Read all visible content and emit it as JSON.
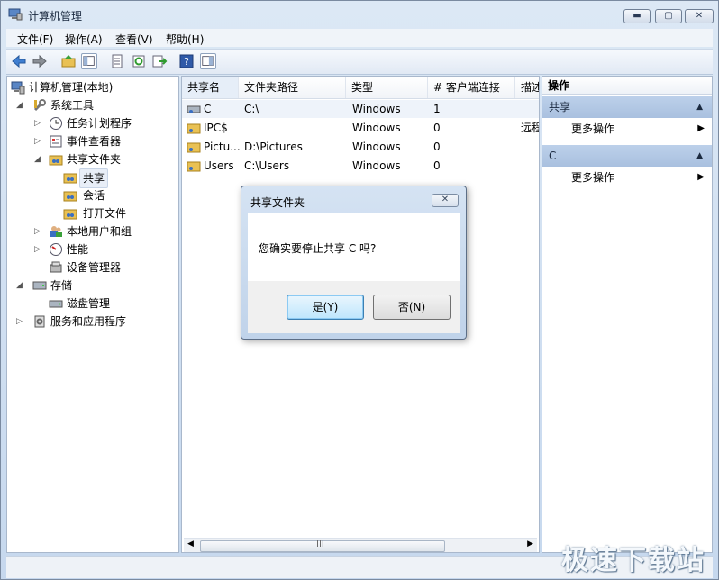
{
  "window": {
    "title": "计算机管理"
  },
  "menu": [
    "文件(F)",
    "操作(A)",
    "查看(V)",
    "帮助(H)"
  ],
  "tree": {
    "items": [
      {
        "label": "计算机管理(本地)",
        "level": 0
      },
      {
        "label": "系统工具",
        "level": 1
      },
      {
        "label": "任务计划程序",
        "level": 2
      },
      {
        "label": "事件查看器",
        "level": 2
      },
      {
        "label": "共享文件夹",
        "level": 2
      },
      {
        "label": "共享",
        "level": 3,
        "selected": true
      },
      {
        "label": "会话",
        "level": 3
      },
      {
        "label": "打开文件",
        "level": 3
      },
      {
        "label": "本地用户和组",
        "level": 2
      },
      {
        "label": "性能",
        "level": 2
      },
      {
        "label": "设备管理器",
        "level": 2
      },
      {
        "label": "存储",
        "level": 1
      },
      {
        "label": "磁盘管理",
        "level": 2
      },
      {
        "label": "服务和应用程序",
        "level": 1
      }
    ]
  },
  "list": {
    "columns": [
      "共享名",
      "文件夹路径",
      "类型",
      "# 客户端连接",
      "描述"
    ],
    "rows": [
      {
        "name": "C",
        "path": "C:\\",
        "type": "Windows",
        "clients": "1",
        "desc": ""
      },
      {
        "name": "IPC$",
        "path": "",
        "type": "Windows",
        "clients": "0",
        "desc": "远程"
      },
      {
        "name": "Pictu...",
        "path": "D:\\Pictures",
        "type": "Windows",
        "clients": "0",
        "desc": ""
      },
      {
        "name": "Users",
        "path": "C:\\Users",
        "type": "Windows",
        "clients": "0",
        "desc": ""
      }
    ],
    "scroll_grip": "III"
  },
  "actions": {
    "header": "操作",
    "section1": {
      "title": "共享",
      "item": "更多操作"
    },
    "section2": {
      "title": "C",
      "item": "更多操作"
    }
  },
  "dialog": {
    "title": "共享文件夹",
    "message": "您确实要停止共享 C 吗?",
    "yes": "是(Y)",
    "no": "否(N)"
  },
  "watermark": "极速下载站",
  "colors": {
    "accent": "#a9c0df",
    "selection": "#e8eef7",
    "default_button": "#bee6fd"
  }
}
